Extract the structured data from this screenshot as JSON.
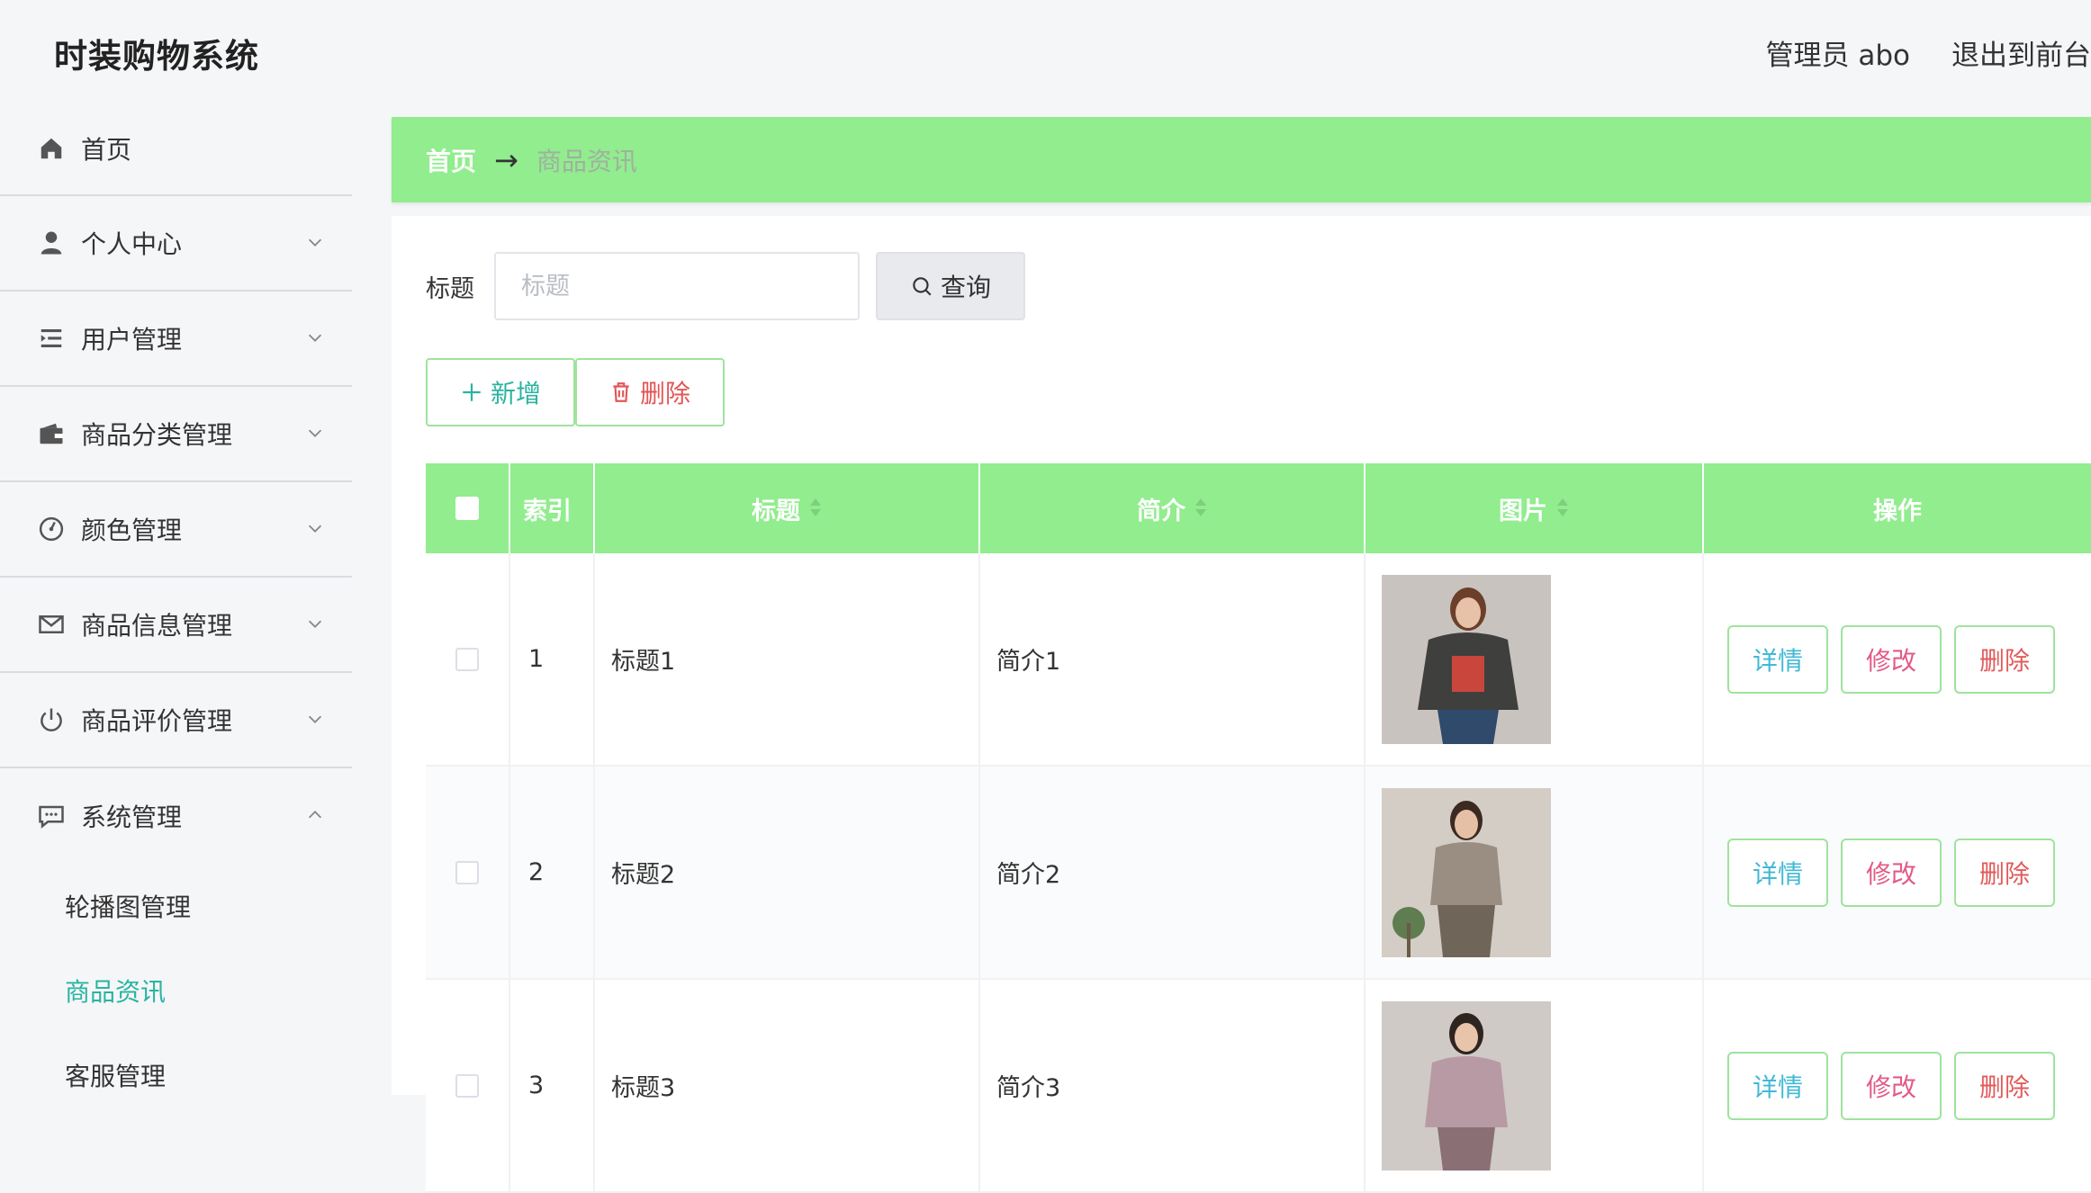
{
  "header": {
    "app_title": "时装购物系统",
    "admin_label": "管理员 abo",
    "exit_label": "退出到前台"
  },
  "sidebar": {
    "items": [
      {
        "label": "首页",
        "icon": "home-icon"
      },
      {
        "label": "个人中心",
        "icon": "user-icon"
      },
      {
        "label": "用户管理",
        "icon": "list-indent-icon"
      },
      {
        "label": "商品分类管理",
        "icon": "wallet-icon"
      },
      {
        "label": "颜色管理",
        "icon": "gauge-icon"
      },
      {
        "label": "商品信息管理",
        "icon": "mail-icon"
      },
      {
        "label": "商品评价管理",
        "icon": "power-icon"
      },
      {
        "label": "系统管理",
        "icon": "chat-icon"
      }
    ],
    "submenu": [
      {
        "label": "轮播图管理"
      },
      {
        "label": "商品资讯",
        "active": true
      },
      {
        "label": "客服管理"
      }
    ]
  },
  "breadcrumb": {
    "home": "首页",
    "arrow": "→",
    "current": "商品资讯"
  },
  "search": {
    "label": "标题",
    "placeholder": "标题",
    "value": "",
    "button": "查询"
  },
  "actions": {
    "add": "新增",
    "delete": "删除"
  },
  "table": {
    "headers": {
      "index": "索引",
      "title": "标题",
      "intro": "简介",
      "image": "图片",
      "ops": "操作"
    },
    "rows": [
      {
        "index": "1",
        "title": "标题1",
        "intro": "简介1",
        "image_colors": [
          "#c9c3bf",
          "#3f3f3d",
          "#2f4a6b"
        ]
      },
      {
        "index": "2",
        "title": "标题2",
        "intro": "简介2",
        "image_colors": [
          "#d3cdc6",
          "#9a8e82",
          "#6f6558"
        ]
      },
      {
        "index": "3",
        "title": "标题3",
        "intro": "简介3",
        "image_colors": [
          "#cfcac6",
          "#b89aa4",
          "#8a6f74"
        ]
      }
    ],
    "op_labels": {
      "detail": "详情",
      "edit": "修改",
      "delete": "删除"
    }
  },
  "colors": {
    "accent_green": "#91ed8e",
    "teal": "#2ab4a0",
    "red": "#e35656"
  }
}
